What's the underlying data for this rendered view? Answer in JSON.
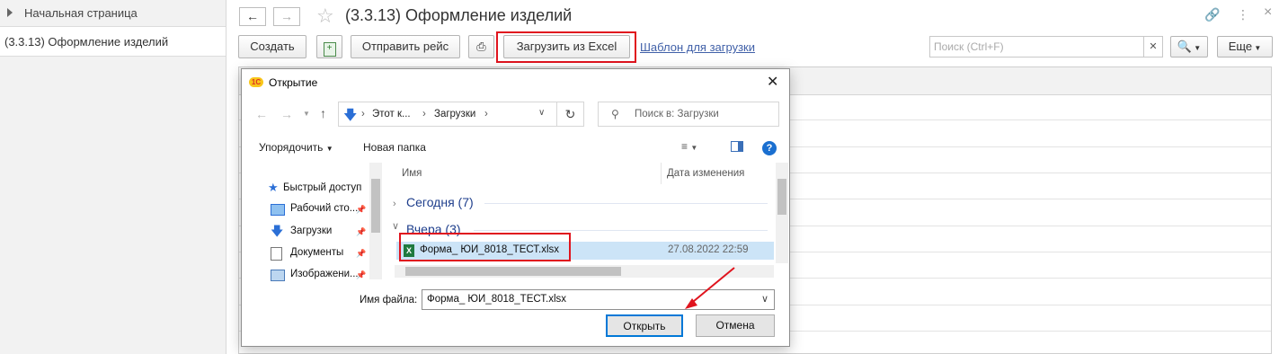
{
  "sidebar": {
    "home": "Начальная страница",
    "current": "(3.3.13) Оформление изделий"
  },
  "header": {
    "title": "(3.3.13) Оформление изделий",
    "back_icon": "arrow-left-icon",
    "forward_icon": "arrow-right-icon",
    "more": "⋮",
    "close": "×"
  },
  "toolbar": {
    "create": "Создать",
    "send_trip": "Отправить рейс",
    "load_excel": "Загрузить из Excel",
    "template_link": "Шаблон для загрузки",
    "search_placeholder": "Поиск (Ctrl+F)",
    "more": "Еще"
  },
  "dialog": {
    "title": "Открытие",
    "path": [
      "Этот к...",
      "Загрузки"
    ],
    "search_placeholder": "Поиск в: Загрузки",
    "organize": "Упорядочить",
    "new_folder": "Новая папка",
    "sidebar_items": [
      {
        "label": "Быстрый доступ",
        "icon": "star-icon"
      },
      {
        "label": "Рабочий сто...",
        "icon": "desktop-icon"
      },
      {
        "label": "Загрузки",
        "icon": "download-icon"
      },
      {
        "label": "Документы",
        "icon": "documents-icon"
      },
      {
        "label": "Изображени...",
        "icon": "pictures-icon"
      }
    ],
    "columns": {
      "name": "Имя",
      "date": "Дата изменения"
    },
    "groups": [
      {
        "label": "Сегодня (7)"
      },
      {
        "label": "Вчера (3)"
      }
    ],
    "file": {
      "name": "Форма_ ЮИ_8018_ТЕСТ.xlsx",
      "date": "27.08.2022 22:59"
    },
    "filename_label": "Имя файла:",
    "filename_value": "Форма_ ЮИ_8018_ТЕСТ.xlsx",
    "open": "Открыть",
    "cancel": "Отмена"
  },
  "colors": {
    "highlight": "#e0141e",
    "link": "#4060a8",
    "selection": "#cce4f7"
  }
}
